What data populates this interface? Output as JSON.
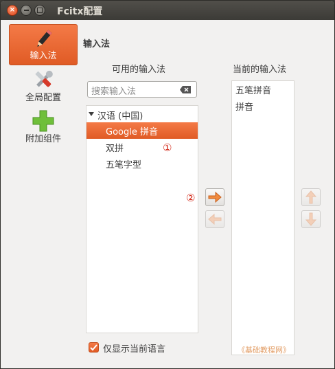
{
  "window": {
    "title": "Fcitx配置"
  },
  "sidebar": {
    "items": [
      {
        "label": "输入法",
        "icon": "pencil-icon",
        "active": true
      },
      {
        "label": "全局配置",
        "icon": "tools-icon",
        "active": false
      },
      {
        "label": "附加组件",
        "icon": "plus-icon",
        "active": false
      }
    ]
  },
  "main": {
    "section_title": "输入法",
    "available": {
      "heading": "可用的输入法",
      "search_placeholder": "搜索输入法",
      "group": "汉语 (中国)",
      "items": [
        "Google 拼音",
        "双拼",
        "五笔字型"
      ],
      "selected_index": 0
    },
    "current": {
      "heading": "当前的输入法",
      "items": [
        "五笔拼音",
        "拼音"
      ]
    },
    "markers": {
      "one": "①",
      "two": "②"
    },
    "show_current_language": {
      "label": "仅显示当前语言",
      "checked": true
    },
    "watermark": "《基础教程网》"
  },
  "colors": {
    "accent": "#e9642d",
    "titlebar": "#3c3b37",
    "marker": "#d42a1a"
  }
}
